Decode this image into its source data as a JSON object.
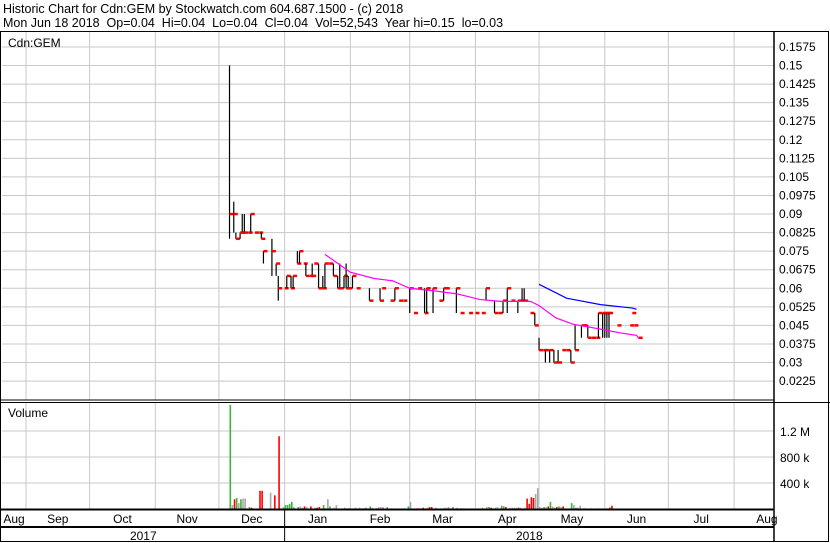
{
  "header": {
    "title": "Historic Chart for Cdn:GEM by Stockwatch.com 604.687.1500 - (c) 2018",
    "quote_line": "Mon Jun 18 2018  Op=0.04  Hi=0.04  Lo=0.04  Cl=0.04  Vol=52,543  Year hi=0.15  lo=0.03"
  },
  "colors": {
    "up": "#3cb43c",
    "down": "#ff0000",
    "flat": "#a8a8a8",
    "ma_short": "#ff00ff",
    "ma_long": "#0000ff",
    "grid": "#c8c8c8"
  },
  "chart_data": [
    {
      "type": "ohlc",
      "title": "Cdn:GEM",
      "x_unit": "days since 2017-09-01",
      "ylim": [
        0.0225,
        0.1575
      ],
      "y_ticks": [
        "0.1575",
        "0.15",
        "0.1425",
        "0.135",
        "0.1275",
        "0.12",
        "0.1125",
        "0.105",
        "0.0975",
        "0.09",
        "0.0825",
        "0.075",
        "0.0675",
        "0.06",
        "0.0525",
        "0.045",
        "0.0375",
        "0.03",
        "0.0225"
      ],
      "bars_day_hi_lo_close": [
        [
          96,
          0.15,
          0.08,
          0.09
        ],
        [
          98,
          0.095,
          0.0825,
          0.09
        ],
        [
          99,
          0.0825,
          0.08,
          0.08
        ],
        [
          101,
          0.0825,
          0.08,
          0.0825
        ],
        [
          102,
          0.09,
          0.0825,
          0.0825
        ],
        [
          103,
          0.09,
          0.0825,
          0.0825
        ],
        [
          105,
          0.0825,
          0.0825,
          0.0825
        ],
        [
          106,
          0.09,
          0.0825,
          0.09
        ],
        [
          108,
          0.0825,
          0.0825,
          0.0825
        ],
        [
          110,
          0.0825,
          0.0825,
          0.0825
        ],
        [
          111,
          0.0825,
          0.08,
          0.08
        ],
        [
          112,
          0.075,
          0.07,
          0.075
        ],
        [
          116,
          0.08,
          0.065,
          0.075
        ],
        [
          118,
          0.07,
          0.065,
          0.07
        ],
        [
          119,
          0.065,
          0.055,
          0.06
        ],
        [
          122,
          0.06,
          0.06,
          0.06
        ],
        [
          123,
          0.065,
          0.06,
          0.065
        ],
        [
          125,
          0.065,
          0.06,
          0.06
        ],
        [
          126,
          0.065,
          0.06,
          0.065
        ],
        [
          128,
          0.075,
          0.07,
          0.07
        ],
        [
          129,
          0.075,
          0.07,
          0.075
        ],
        [
          131,
          0.07,
          0.07,
          0.07
        ],
        [
          132,
          0.07,
          0.065,
          0.065
        ],
        [
          134,
          0.065,
          0.065,
          0.065
        ],
        [
          135,
          0.07,
          0.065,
          0.065
        ],
        [
          136,
          0.07,
          0.07,
          0.07
        ],
        [
          138,
          0.07,
          0.06,
          0.06
        ],
        [
          140,
          0.065,
          0.06,
          0.06
        ],
        [
          141,
          0.07,
          0.06,
          0.07
        ],
        [
          143,
          0.07,
          0.07,
          0.07
        ],
        [
          145,
          0.07,
          0.065,
          0.065
        ],
        [
          147,
          0.065,
          0.06,
          0.06
        ],
        [
          148,
          0.07,
          0.06,
          0.06
        ],
        [
          150,
          0.065,
          0.06,
          0.065
        ],
        [
          151,
          0.07,
          0.06,
          0.06
        ],
        [
          152,
          0.065,
          0.06,
          0.06
        ],
        [
          154,
          0.065,
          0.06,
          0.065
        ],
        [
          156,
          0.06,
          0.06,
          0.06
        ],
        [
          162,
          0.06,
          0.055,
          0.055
        ],
        [
          167,
          0.06,
          0.055,
          0.055
        ],
        [
          168,
          0.06,
          0.06,
          0.06
        ],
        [
          172,
          0.055,
          0.055,
          0.055
        ],
        [
          174,
          0.06,
          0.055,
          0.06
        ],
        [
          176,
          0.055,
          0.055,
          0.055
        ],
        [
          178,
          0.055,
          0.055,
          0.055
        ],
        [
          181,
          0.06,
          0.05,
          0.06
        ],
        [
          183,
          0.05,
          0.05,
          0.05
        ],
        [
          185,
          0.06,
          0.06,
          0.06
        ],
        [
          188,
          0.06,
          0.05,
          0.05
        ],
        [
          189,
          0.06,
          0.05,
          0.06
        ],
        [
          192,
          0.06,
          0.05,
          0.06
        ],
        [
          195,
          0.055,
          0.055,
          0.055
        ],
        [
          197,
          0.06,
          0.055,
          0.06
        ],
        [
          198,
          0.06,
          0.06,
          0.06
        ],
        [
          203,
          0.06,
          0.05,
          0.06
        ],
        [
          205,
          0.05,
          0.05,
          0.05
        ],
        [
          209,
          0.05,
          0.05,
          0.05
        ],
        [
          212,
          0.05,
          0.05,
          0.05
        ],
        [
          215,
          0.05,
          0.05,
          0.05
        ],
        [
          217,
          0.06,
          0.055,
          0.06
        ],
        [
          221,
          0.055,
          0.05,
          0.05
        ],
        [
          223,
          0.05,
          0.05,
          0.05
        ],
        [
          225,
          0.055,
          0.05,
          0.055
        ],
        [
          227,
          0.06,
          0.05,
          0.06
        ],
        [
          229,
          0.055,
          0.055,
          0.055
        ],
        [
          232,
          0.055,
          0.05,
          0.055
        ],
        [
          234,
          0.06,
          0.055,
          0.055
        ],
        [
          235,
          0.06,
          0.055,
          0.055
        ],
        [
          238,
          0.05,
          0.05,
          0.05
        ],
        [
          240,
          0.05,
          0.045,
          0.045
        ],
        [
          242,
          0.04,
          0.035,
          0.035
        ],
        [
          244,
          0.035,
          0.035,
          0.035
        ],
        [
          245,
          0.035,
          0.03,
          0.035
        ],
        [
          247,
          0.035,
          0.03,
          0.035
        ],
        [
          249,
          0.035,
          0.03,
          0.03
        ],
        [
          251,
          0.035,
          0.03,
          0.03
        ],
        [
          253,
          0.035,
          0.035,
          0.035
        ],
        [
          255,
          0.035,
          0.035,
          0.035
        ],
        [
          257,
          0.035,
          0.03,
          0.03
        ],
        [
          259,
          0.045,
          0.035,
          0.035
        ],
        [
          262,
          0.045,
          0.04,
          0.045
        ],
        [
          263,
          0.045,
          0.045,
          0.045
        ],
        [
          265,
          0.045,
          0.04,
          0.04
        ],
        [
          267,
          0.04,
          0.04,
          0.04
        ],
        [
          269,
          0.04,
          0.04,
          0.04
        ],
        [
          270,
          0.05,
          0.04,
          0.05
        ],
        [
          272,
          0.05,
          0.04,
          0.05
        ],
        [
          273,
          0.05,
          0.04,
          0.05
        ],
        [
          274,
          0.05,
          0.04,
          0.05
        ],
        [
          275,
          0.05,
          0.04,
          0.05
        ],
        [
          279,
          0.045,
          0.045,
          0.045
        ],
        [
          285,
          0.045,
          0.045,
          0.045
        ],
        [
          286,
          0.05,
          0.05,
          0.05
        ],
        [
          287,
          0.045,
          0.045,
          0.045
        ],
        [
          289,
          0.04,
          0.04,
          0.04
        ]
      ],
      "ma_short": [
        [
          141,
          0.0737
        ],
        [
          153,
          0.0665
        ],
        [
          164,
          0.064
        ],
        [
          173,
          0.063
        ],
        [
          181,
          0.06
        ],
        [
          192,
          0.059
        ],
        [
          203,
          0.0578
        ],
        [
          214,
          0.0555
        ],
        [
          224,
          0.0547
        ],
        [
          238,
          0.0547
        ],
        [
          242,
          0.053
        ],
        [
          250,
          0.048
        ],
        [
          258,
          0.0455
        ],
        [
          271,
          0.0435
        ],
        [
          280,
          0.042
        ],
        [
          288,
          0.041
        ],
        [
          289,
          0.0397
        ]
      ],
      "ma_long": [
        [
          242,
          0.0616
        ],
        [
          255,
          0.056
        ],
        [
          271,
          0.0534
        ],
        [
          286,
          0.052
        ],
        [
          288,
          0.0515
        ]
      ]
    },
    {
      "type": "bar",
      "title": "Volume",
      "y_ticks": [
        {
          "label": "1.2 M",
          "value": 1200000
        },
        {
          "label": "800 k",
          "value": 800000
        },
        {
          "label": "400 k",
          "value": 400000
        }
      ],
      "ylim": [
        0,
        1600000
      ],
      "bars_day_volume_dir": [
        [
          96,
          1600000,
          "up"
        ],
        [
          97,
          60000,
          "flat"
        ],
        [
          98,
          150000,
          "down"
        ],
        [
          99,
          170000,
          "up"
        ],
        [
          100,
          90000,
          "flat"
        ],
        [
          101,
          150000,
          "up"
        ],
        [
          102,
          160000,
          "flat"
        ],
        [
          103,
          160000,
          "flat"
        ],
        [
          105,
          30000,
          "up"
        ],
        [
          106,
          20000,
          "down"
        ],
        [
          110,
          280000,
          "down"
        ],
        [
          111,
          280000,
          "down"
        ],
        [
          115,
          250000,
          "flat"
        ],
        [
          117,
          210000,
          "down"
        ],
        [
          119,
          1120000,
          "down"
        ],
        [
          121,
          30000,
          "flat"
        ],
        [
          122,
          60000,
          "up"
        ],
        [
          123,
          60000,
          "up"
        ],
        [
          124,
          80000,
          "up"
        ],
        [
          125,
          110000,
          "up"
        ],
        [
          126,
          30000,
          "flat"
        ],
        [
          128,
          30000,
          "up"
        ],
        [
          129,
          40000,
          "flat"
        ],
        [
          130,
          20000,
          "flat"
        ],
        [
          131,
          40000,
          "down"
        ],
        [
          132,
          30000,
          "flat"
        ],
        [
          134,
          40000,
          "down"
        ],
        [
          136,
          20000,
          "flat"
        ],
        [
          137,
          20000,
          "down"
        ],
        [
          138,
          30000,
          "down"
        ],
        [
          140,
          60000,
          "up"
        ],
        [
          141,
          10000,
          "flat"
        ],
        [
          142,
          150000,
          "flat"
        ],
        [
          143,
          40000,
          "up"
        ],
        [
          145,
          20000,
          "flat"
        ],
        [
          146,
          60000,
          "flat"
        ],
        [
          150,
          20000,
          "flat"
        ],
        [
          152,
          10000,
          "down"
        ],
        [
          155,
          20000,
          "flat"
        ],
        [
          157,
          20000,
          "flat"
        ],
        [
          159,
          10000,
          "down"
        ],
        [
          160,
          20000,
          "up"
        ],
        [
          162,
          40000,
          "up"
        ],
        [
          163,
          20000,
          "flat"
        ],
        [
          165,
          10000,
          "down"
        ],
        [
          166,
          30000,
          "flat"
        ],
        [
          167,
          30000,
          "flat"
        ],
        [
          168,
          30000,
          "flat"
        ],
        [
          170,
          30000,
          "up"
        ],
        [
          172,
          10000,
          "flat"
        ],
        [
          175,
          10000,
          "flat"
        ],
        [
          178,
          10000,
          "flat"
        ],
        [
          180,
          40000,
          "up"
        ],
        [
          181,
          110000,
          "flat"
        ],
        [
          184,
          10000,
          "down"
        ],
        [
          185,
          10000,
          "down"
        ],
        [
          187,
          20000,
          "down"
        ],
        [
          189,
          20000,
          "flat"
        ],
        [
          190,
          30000,
          "down"
        ],
        [
          191,
          30000,
          "down"
        ],
        [
          193,
          20000,
          "flat"
        ],
        [
          195,
          10000,
          "flat"
        ],
        [
          197,
          20000,
          "flat"
        ],
        [
          198,
          20000,
          "flat"
        ],
        [
          199,
          30000,
          "flat"
        ],
        [
          201,
          30000,
          "up"
        ],
        [
          203,
          20000,
          "flat"
        ],
        [
          205,
          10000,
          "down"
        ],
        [
          210,
          10000,
          "flat"
        ],
        [
          213,
          10000,
          "flat"
        ],
        [
          215,
          20000,
          "flat"
        ],
        [
          217,
          30000,
          "flat"
        ],
        [
          218,
          30000,
          "up"
        ],
        [
          219,
          20000,
          "down"
        ],
        [
          221,
          20000,
          "flat"
        ],
        [
          222,
          30000,
          "flat"
        ],
        [
          224,
          50000,
          "up"
        ],
        [
          225,
          40000,
          "up"
        ],
        [
          226,
          30000,
          "down"
        ],
        [
          228,
          20000,
          "flat"
        ],
        [
          229,
          20000,
          "flat"
        ],
        [
          230,
          20000,
          "flat"
        ],
        [
          231,
          20000,
          "flat"
        ],
        [
          232,
          20000,
          "down"
        ],
        [
          233,
          20000,
          "flat"
        ],
        [
          235,
          20000,
          "flat"
        ],
        [
          236,
          160000,
          "down"
        ],
        [
          237,
          80000,
          "down"
        ],
        [
          238,
          180000,
          "down"
        ],
        [
          239,
          170000,
          "down"
        ],
        [
          240,
          230000,
          "flat"
        ],
        [
          241,
          320000,
          "flat"
        ],
        [
          242,
          30000,
          "flat"
        ],
        [
          243,
          20000,
          "flat"
        ],
        [
          244,
          30000,
          "up"
        ],
        [
          245,
          30000,
          "flat"
        ],
        [
          246,
          40000,
          "down"
        ],
        [
          247,
          110000,
          "up"
        ],
        [
          248,
          40000,
          "flat"
        ],
        [
          249,
          20000,
          "up"
        ],
        [
          250,
          30000,
          "down"
        ],
        [
          251,
          40000,
          "up"
        ],
        [
          252,
          30000,
          "flat"
        ],
        [
          253,
          40000,
          "down"
        ],
        [
          254,
          10000,
          "flat"
        ],
        [
          256,
          10000,
          "up"
        ],
        [
          257,
          90000,
          "up"
        ],
        [
          258,
          60000,
          "flat"
        ],
        [
          259,
          20000,
          "up"
        ],
        [
          260,
          20000,
          "flat"
        ],
        [
          261,
          50000,
          "flat"
        ],
        [
          263,
          10000,
          "down"
        ],
        [
          266,
          10000,
          "flat"
        ],
        [
          270,
          10000,
          "flat"
        ],
        [
          272,
          10000,
          "flat"
        ],
        [
          274,
          10000,
          "flat"
        ],
        [
          275,
          20000,
          "down"
        ],
        [
          276,
          50000,
          "down"
        ]
      ]
    }
  ],
  "x_axis": {
    "months": [
      {
        "label": "Aug",
        "day": -31
      },
      {
        "label": "Sep",
        "day": 0
      },
      {
        "label": "Oct",
        "day": 30
      },
      {
        "label": "Nov",
        "day": 61
      },
      {
        "label": "Dec",
        "day": 91
      },
      {
        "label": "Jan",
        "day": 122
      },
      {
        "label": "Feb",
        "day": 153
      },
      {
        "label": "Mar",
        "day": 181
      },
      {
        "label": "Apr",
        "day": 212
      },
      {
        "label": "May",
        "day": 242
      },
      {
        "label": "Jun",
        "day": 273
      },
      {
        "label": "Jul",
        "day": 303
      },
      {
        "label": "Aug",
        "day": 334
      },
      {
        "label": "",
        "day": 365
      }
    ],
    "years": [
      {
        "label": "2017"
      },
      {
        "label": "2018"
      }
    ]
  }
}
